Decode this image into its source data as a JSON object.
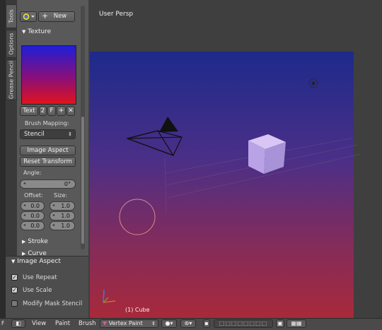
{
  "tabs": [
    "Tools",
    "Options",
    "Grease Pencil"
  ],
  "toolbar": {
    "new_label": "New"
  },
  "texture": {
    "section_label": "Texture",
    "slot_name": "Text",
    "users": "2",
    "fake_user": "F",
    "brush_mapping_label": "Brush Mapping:",
    "brush_mapping_value": "Stencil",
    "image_aspect_button": "Image Aspect",
    "reset_transform_button": "Reset Transform",
    "angle_label": "Angle:",
    "angle_value": "0°",
    "offset_label": "Offset:",
    "size_label": "Size:",
    "offset_values": [
      "0.0",
      "0.0",
      "0.0"
    ],
    "size_values": [
      "1.0",
      "1.0",
      "1.0"
    ]
  },
  "sections": {
    "stroke": "Stroke",
    "curve": "Curve"
  },
  "operator": {
    "title": "Image Aspect",
    "options": [
      {
        "label": "Use Repeat",
        "checked": true
      },
      {
        "label": "Use Scale",
        "checked": true
      },
      {
        "label": "Modify Mask Stencil",
        "checked": false
      }
    ]
  },
  "viewport": {
    "view_name": "User Persp",
    "object_label": "(1) Cube"
  },
  "header": {
    "menus": [
      "View",
      "Paint",
      "Brush"
    ],
    "mode": "Vertex Paint",
    "left_fragment": "F"
  },
  "colors": {
    "panel": "#595959",
    "viewport": "#3f3f3f",
    "cube": "#b9a3e6"
  }
}
